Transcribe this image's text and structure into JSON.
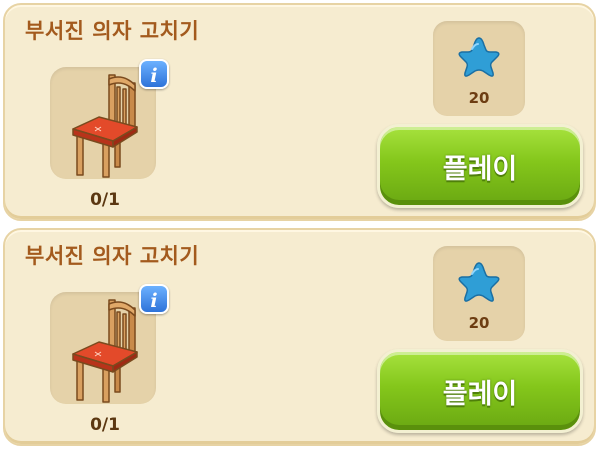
{
  "cards": [
    {
      "title": "부서진 의자 고치기",
      "info_label": "i",
      "progress": "0/1",
      "reward_icon": "blue-star-icon",
      "reward_amount": "20",
      "play_label": "플레이"
    },
    {
      "title": "부서진 의자 고치기",
      "info_label": "i",
      "progress": "0/1",
      "reward_icon": "blue-star-icon",
      "reward_amount": "20",
      "play_label": "플레이"
    }
  ],
  "colors": {
    "card_bg": "#f6ecd0",
    "title": "#a35a1d",
    "play_button": "#84c61b",
    "info_button": "#2e73d9",
    "star": "#2f9ed6"
  }
}
